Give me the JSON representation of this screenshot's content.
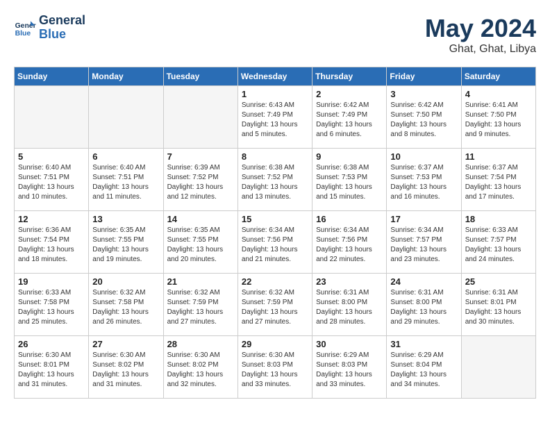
{
  "header": {
    "logo_line1": "General",
    "logo_line2": "Blue",
    "title": "May 2024",
    "subtitle": "Ghat, Ghat, Libya"
  },
  "weekdays": [
    "Sunday",
    "Monday",
    "Tuesday",
    "Wednesday",
    "Thursday",
    "Friday",
    "Saturday"
  ],
  "weeks": [
    [
      {
        "day": "",
        "info": ""
      },
      {
        "day": "",
        "info": ""
      },
      {
        "day": "",
        "info": ""
      },
      {
        "day": "1",
        "info": "Sunrise: 6:43 AM\nSunset: 7:49 PM\nDaylight: 13 hours\nand 5 minutes."
      },
      {
        "day": "2",
        "info": "Sunrise: 6:42 AM\nSunset: 7:49 PM\nDaylight: 13 hours\nand 6 minutes."
      },
      {
        "day": "3",
        "info": "Sunrise: 6:42 AM\nSunset: 7:50 PM\nDaylight: 13 hours\nand 8 minutes."
      },
      {
        "day": "4",
        "info": "Sunrise: 6:41 AM\nSunset: 7:50 PM\nDaylight: 13 hours\nand 9 minutes."
      }
    ],
    [
      {
        "day": "5",
        "info": "Sunrise: 6:40 AM\nSunset: 7:51 PM\nDaylight: 13 hours\nand 10 minutes."
      },
      {
        "day": "6",
        "info": "Sunrise: 6:40 AM\nSunset: 7:51 PM\nDaylight: 13 hours\nand 11 minutes."
      },
      {
        "day": "7",
        "info": "Sunrise: 6:39 AM\nSunset: 7:52 PM\nDaylight: 13 hours\nand 12 minutes."
      },
      {
        "day": "8",
        "info": "Sunrise: 6:38 AM\nSunset: 7:52 PM\nDaylight: 13 hours\nand 13 minutes."
      },
      {
        "day": "9",
        "info": "Sunrise: 6:38 AM\nSunset: 7:53 PM\nDaylight: 13 hours\nand 15 minutes."
      },
      {
        "day": "10",
        "info": "Sunrise: 6:37 AM\nSunset: 7:53 PM\nDaylight: 13 hours\nand 16 minutes."
      },
      {
        "day": "11",
        "info": "Sunrise: 6:37 AM\nSunset: 7:54 PM\nDaylight: 13 hours\nand 17 minutes."
      }
    ],
    [
      {
        "day": "12",
        "info": "Sunrise: 6:36 AM\nSunset: 7:54 PM\nDaylight: 13 hours\nand 18 minutes."
      },
      {
        "day": "13",
        "info": "Sunrise: 6:35 AM\nSunset: 7:55 PM\nDaylight: 13 hours\nand 19 minutes."
      },
      {
        "day": "14",
        "info": "Sunrise: 6:35 AM\nSunset: 7:55 PM\nDaylight: 13 hours\nand 20 minutes."
      },
      {
        "day": "15",
        "info": "Sunrise: 6:34 AM\nSunset: 7:56 PM\nDaylight: 13 hours\nand 21 minutes."
      },
      {
        "day": "16",
        "info": "Sunrise: 6:34 AM\nSunset: 7:56 PM\nDaylight: 13 hours\nand 22 minutes."
      },
      {
        "day": "17",
        "info": "Sunrise: 6:34 AM\nSunset: 7:57 PM\nDaylight: 13 hours\nand 23 minutes."
      },
      {
        "day": "18",
        "info": "Sunrise: 6:33 AM\nSunset: 7:57 PM\nDaylight: 13 hours\nand 24 minutes."
      }
    ],
    [
      {
        "day": "19",
        "info": "Sunrise: 6:33 AM\nSunset: 7:58 PM\nDaylight: 13 hours\nand 25 minutes."
      },
      {
        "day": "20",
        "info": "Sunrise: 6:32 AM\nSunset: 7:58 PM\nDaylight: 13 hours\nand 26 minutes."
      },
      {
        "day": "21",
        "info": "Sunrise: 6:32 AM\nSunset: 7:59 PM\nDaylight: 13 hours\nand 27 minutes."
      },
      {
        "day": "22",
        "info": "Sunrise: 6:32 AM\nSunset: 7:59 PM\nDaylight: 13 hours\nand 27 minutes."
      },
      {
        "day": "23",
        "info": "Sunrise: 6:31 AM\nSunset: 8:00 PM\nDaylight: 13 hours\nand 28 minutes."
      },
      {
        "day": "24",
        "info": "Sunrise: 6:31 AM\nSunset: 8:00 PM\nDaylight: 13 hours\nand 29 minutes."
      },
      {
        "day": "25",
        "info": "Sunrise: 6:31 AM\nSunset: 8:01 PM\nDaylight: 13 hours\nand 30 minutes."
      }
    ],
    [
      {
        "day": "26",
        "info": "Sunrise: 6:30 AM\nSunset: 8:01 PM\nDaylight: 13 hours\nand 31 minutes."
      },
      {
        "day": "27",
        "info": "Sunrise: 6:30 AM\nSunset: 8:02 PM\nDaylight: 13 hours\nand 31 minutes."
      },
      {
        "day": "28",
        "info": "Sunrise: 6:30 AM\nSunset: 8:02 PM\nDaylight: 13 hours\nand 32 minutes."
      },
      {
        "day": "29",
        "info": "Sunrise: 6:30 AM\nSunset: 8:03 PM\nDaylight: 13 hours\nand 33 minutes."
      },
      {
        "day": "30",
        "info": "Sunrise: 6:29 AM\nSunset: 8:03 PM\nDaylight: 13 hours\nand 33 minutes."
      },
      {
        "day": "31",
        "info": "Sunrise: 6:29 AM\nSunset: 8:04 PM\nDaylight: 13 hours\nand 34 minutes."
      },
      {
        "day": "",
        "info": ""
      }
    ]
  ]
}
